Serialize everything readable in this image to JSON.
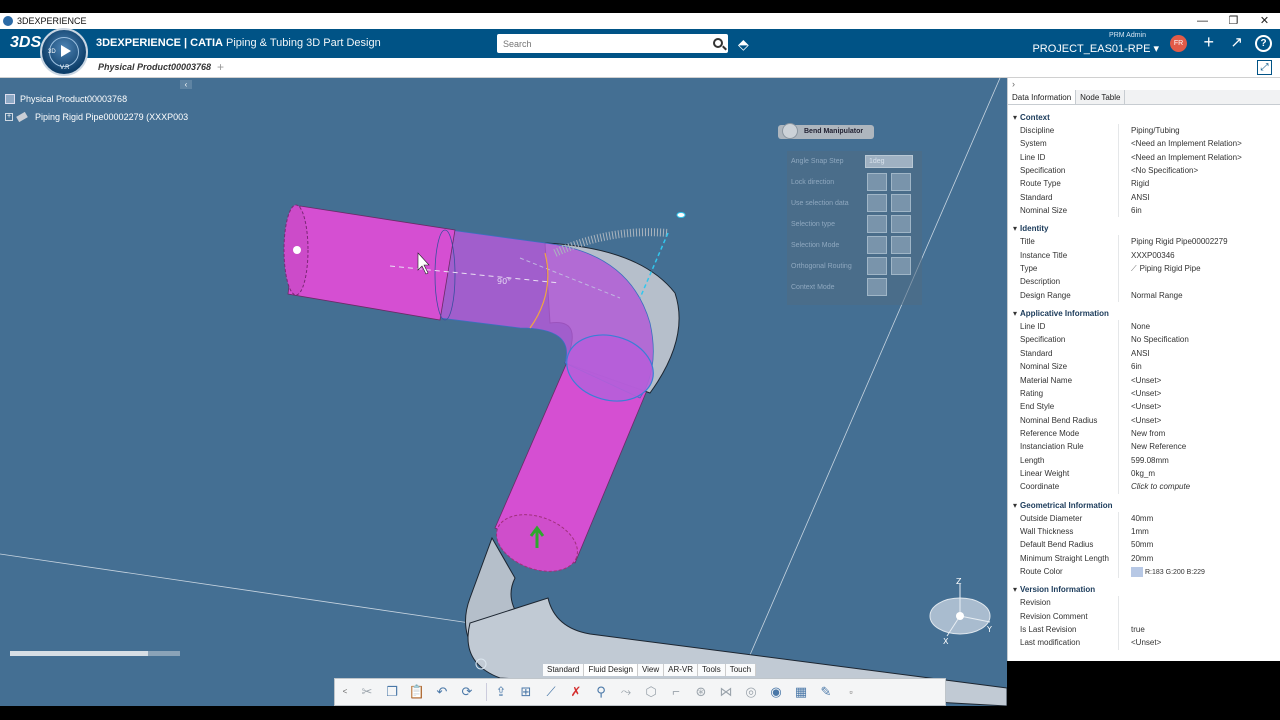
{
  "window": {
    "title": "3DEXPERIENCE",
    "controls": [
      "—",
      "❐",
      "✕"
    ]
  },
  "header": {
    "logo": "3DS",
    "compass_top": "3D",
    "compass_bottom": "V.R",
    "brand_bold": "3DEXPERIENCE | CATIA",
    "app_name": "Piping & Tubing 3D Part Design",
    "search_placeholder": "Search",
    "role": "PRM  Admin",
    "project": "PROJECT_EAS01-RPE ▾",
    "avatar": "FR",
    "help": "?"
  },
  "tabs": {
    "active": "Physical Product00003768",
    "add": "+"
  },
  "tree": {
    "root": "Physical Product00003768",
    "child": "Piping Rigid Pipe00002279 (XXXP003"
  },
  "bend_manipulator": {
    "title": "Bend Manipulator",
    "angle_snap_step": "Angle Snap Step",
    "angle_snap_value": "1deg",
    "lock_direction": "Lock direction",
    "use_selection_data": "Use selection data",
    "selection_type": "Selection type",
    "selection_mode": "Selection Mode",
    "orthogonal_routing": "Orthogonal Routing",
    "context_mode": "Context Mode"
  },
  "scene": {
    "angle_label": "90°",
    "compass_z": "Z",
    "compass_x": "X",
    "compass_y": "Y"
  },
  "actionbar": {
    "tabs": [
      "Standard",
      "Fluid Design",
      "View",
      "AR-VR",
      "Tools",
      "Touch"
    ],
    "active_tab": "Fluid Design",
    "toggle": "<"
  },
  "panel": {
    "tabs": [
      "Data Information",
      "Node Table"
    ],
    "active_tab": "Data Information",
    "sections": [
      {
        "title": "Context",
        "rows": [
          [
            "Discipline",
            "Piping/Tubing"
          ],
          [
            "System",
            "<Need an Implement Relation>"
          ],
          [
            "Line ID",
            "<Need an Implement Relation>"
          ],
          [
            "Specification",
            "<No Specification>"
          ],
          [
            "Route Type",
            "Rigid"
          ],
          [
            "Standard",
            "ANSI"
          ],
          [
            "Nominal Size",
            "6in"
          ]
        ]
      },
      {
        "title": "Identity",
        "rows": [
          [
            "Title",
            "Piping Rigid Pipe00002279"
          ],
          [
            "Instance Title",
            "XXXP00346"
          ],
          [
            "Type",
            "Piping Rigid Pipe"
          ],
          [
            "Description",
            ""
          ],
          [
            "Design Range",
            "Normal Range"
          ]
        ]
      },
      {
        "title": "Applicative Information",
        "rows": [
          [
            "Line ID",
            "None"
          ],
          [
            "Specification",
            "No Specification"
          ],
          [
            "Standard",
            "ANSI"
          ],
          [
            "Nominal Size",
            "6in"
          ],
          [
            "Material Name",
            "<Unset>"
          ],
          [
            "Rating",
            "<Unset>"
          ],
          [
            "End Style",
            "<Unset>"
          ],
          [
            "Nominal Bend Radius",
            "<Unset>"
          ],
          [
            "Reference Mode",
            "New from"
          ],
          [
            "Instanciation Rule",
            "New Reference"
          ],
          [
            "Length",
            "599.08mm"
          ],
          [
            "Linear Weight",
            "0kg_m"
          ],
          [
            "Coordinate",
            "Click to compute"
          ]
        ]
      },
      {
        "title": "Geometrical Information",
        "rows": [
          [
            "Outside Diameter",
            "40mm"
          ],
          [
            "Wall Thickness",
            "1mm"
          ],
          [
            "Default Bend Radius",
            "50mm"
          ],
          [
            "Minimum Straight Length",
            "20mm"
          ],
          [
            "Route Color",
            "R:183 G:200 B:229"
          ]
        ]
      },
      {
        "title": "Version Information",
        "rows": [
          [
            "Revision",
            ""
          ],
          [
            "Revision Comment",
            ""
          ],
          [
            "Is Last Revision",
            "true"
          ],
          [
            "Last modification",
            "<Unset>"
          ]
        ]
      }
    ]
  },
  "colors": {
    "header": "#005386",
    "viewport": "#446f93",
    "pipe_selected": "#d14fc9",
    "pipe_grey": "#b8c2cd",
    "route_color": "#b7c8e5"
  }
}
